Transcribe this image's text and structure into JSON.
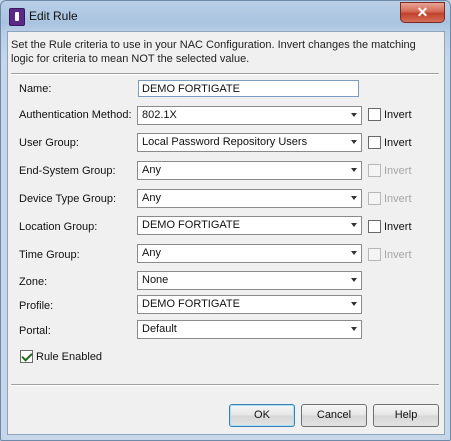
{
  "window": {
    "title": "Edit Rule",
    "close_label": "✕"
  },
  "description": "Set the Rule criteria to use in your NAC Configuration. Invert changes the matching logic for criteria to mean NOT the selected value.",
  "fields": {
    "name": {
      "label": "Name:",
      "value": "DEMO FORTIGATE"
    },
    "auth_method": {
      "label": "Authentication Method:",
      "value": "802.1X",
      "invert": "Invert"
    },
    "user_group": {
      "label": "User Group:",
      "value": "Local Password Repository Users",
      "invert": "Invert"
    },
    "end_system_group": {
      "label": "End-System Group:",
      "value": "Any",
      "invert": "Invert"
    },
    "device_type_group": {
      "label": "Device Type Group:",
      "value": "Any",
      "invert": "Invert"
    },
    "location_group": {
      "label": "Location Group:",
      "value": "DEMO FORTIGATE",
      "invert": "Invert"
    },
    "time_group": {
      "label": "Time Group:",
      "value": "Any",
      "invert": "Invert"
    },
    "zone": {
      "label": "Zone:",
      "value": "None"
    },
    "profile": {
      "label": "Profile:",
      "value": "DEMO FORTIGATE"
    },
    "portal": {
      "label": "Portal:",
      "value": "Default"
    }
  },
  "rule_enabled": {
    "label": "Rule Enabled",
    "checked": true
  },
  "buttons": {
    "ok": "OK",
    "cancel": "Cancel",
    "help": "Help"
  }
}
